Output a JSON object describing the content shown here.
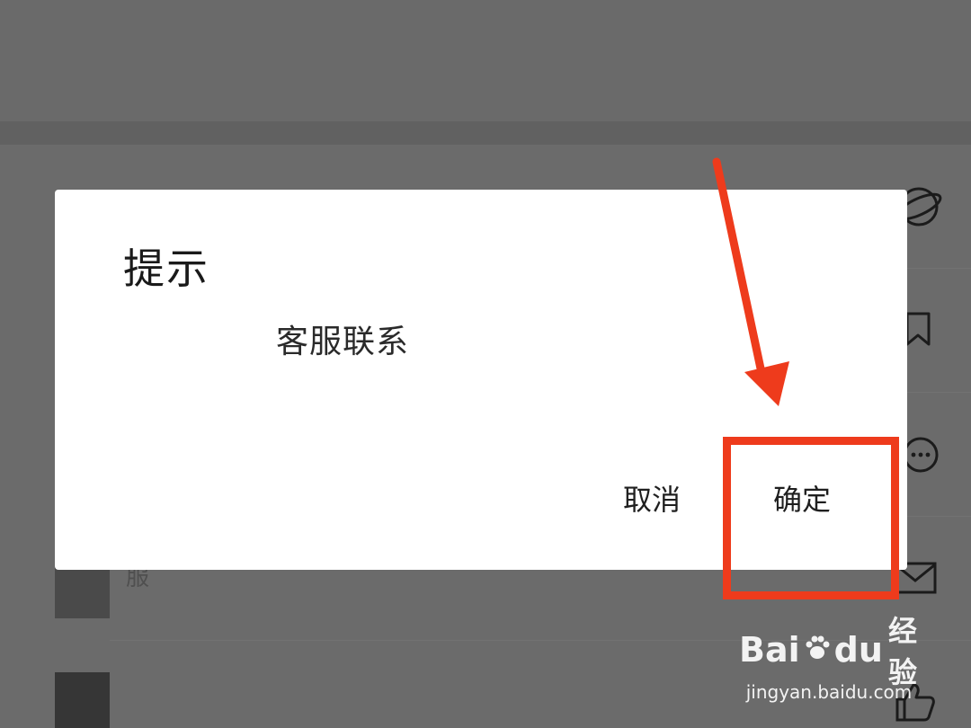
{
  "dialog": {
    "title": "提示",
    "message": "客服联系",
    "cancel_label": "取消",
    "confirm_label": "确定"
  },
  "background": {
    "row_text": "服"
  },
  "icons": {
    "row_1": "planet-icon",
    "row_2": "bookmark-icon",
    "row_3": "chat-bubble-icon",
    "row_4": "mail-icon",
    "row_5": "thumbs-up-icon"
  },
  "annotation": {
    "highlight_color": "#ee3b1c"
  },
  "watermark": {
    "logo_left": "Bai",
    "logo_right": "du",
    "logo_cn": "经验",
    "url": "jingyan.baidu.com"
  },
  "colors": {
    "overlay": "#6b6b6b",
    "dialog_bg": "#ffffff"
  }
}
